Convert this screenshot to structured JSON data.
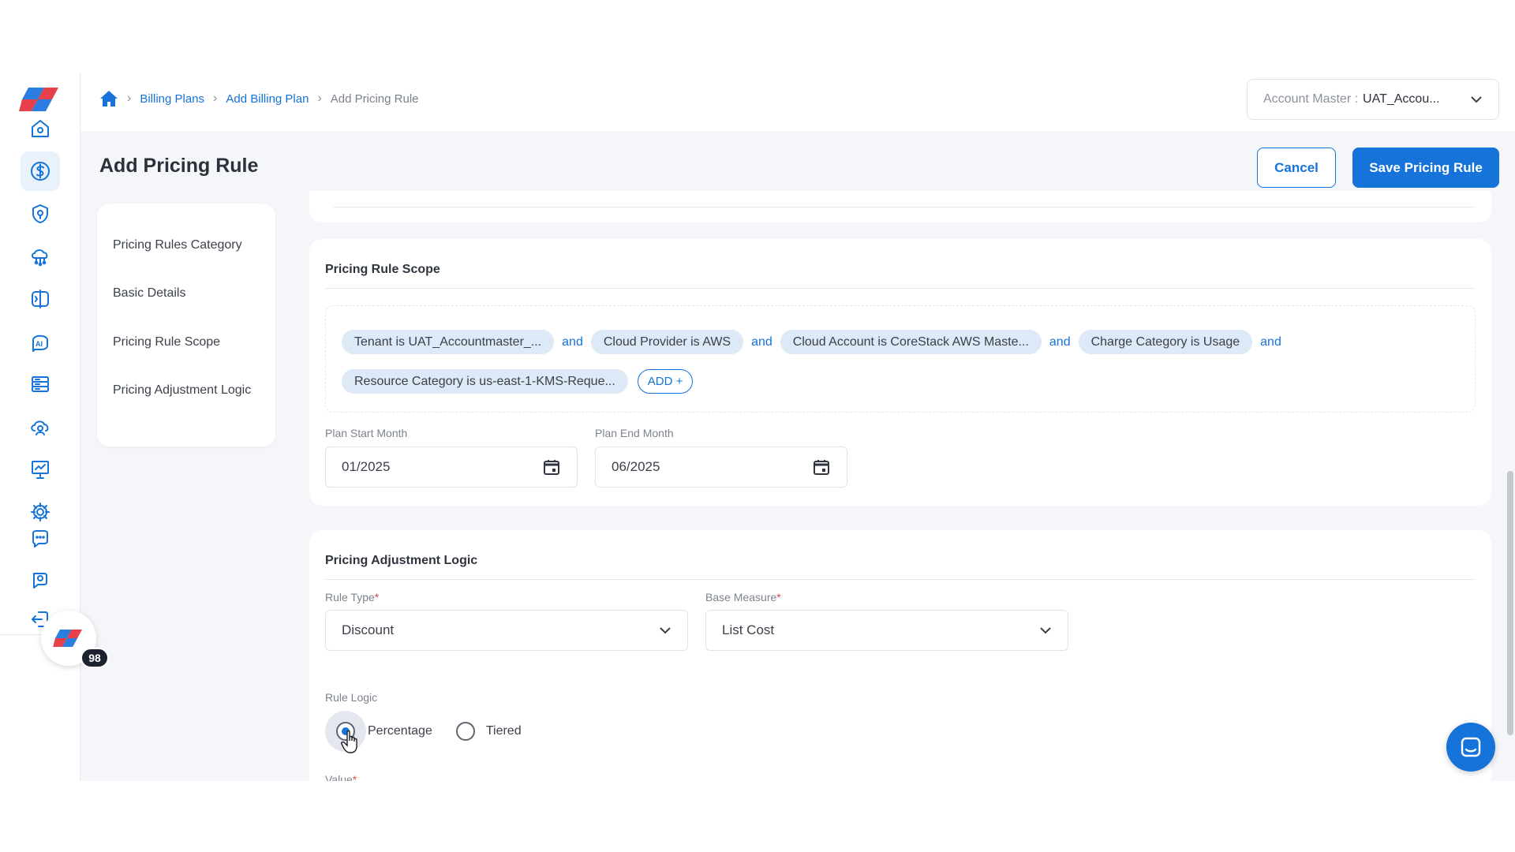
{
  "breadcrumb": {
    "home_icon": "home-icon",
    "items": [
      "Billing Plans",
      "Add Billing Plan"
    ],
    "current": "Add Pricing Rule"
  },
  "account": {
    "label": "Account Master :",
    "value": "UAT_Accou..."
  },
  "header": {
    "title": "Add Pricing Rule",
    "cancel_label": "Cancel",
    "save_label": "Save Pricing Rule"
  },
  "section_nav": [
    "Pricing Rules Category",
    "Basic Details",
    "Pricing Rule Scope",
    "Pricing Adjustment Logic"
  ],
  "scope": {
    "title": "Pricing Rule Scope",
    "conjunction": "and",
    "chips": [
      "Tenant is UAT_Accountmaster_...",
      "Cloud Provider is AWS",
      "Cloud Account is CoreStack AWS Maste...",
      "Charge Category is Usage",
      "Resource Category is us-east-1-KMS-Reque..."
    ],
    "add_label": "ADD +",
    "start_label": "Plan Start Month",
    "start_value": "01/2025",
    "end_label": "Plan End Month",
    "end_value": "06/2025"
  },
  "logic": {
    "title": "Pricing Adjustment Logic",
    "rule_type_label": "Rule Type",
    "rule_type_value": "Discount",
    "base_measure_label": "Base Measure",
    "base_measure_value": "List Cost",
    "rule_logic_label": "Rule Logic",
    "options": [
      "Percentage",
      "Tiered"
    ],
    "selected": "Percentage",
    "value_label": "Value",
    "required_mark": "*"
  },
  "notification_count": "98",
  "colors": {
    "accent": "#1573d9",
    "chip_bg": "#dde9f6",
    "page_bg": "#f4f6fa"
  },
  "sidebar_icons": [
    "home-icon",
    "dollar-icon",
    "shield-icon",
    "cloud-network-icon",
    "split-panel-icon",
    "ai-icon",
    "server-icon",
    "cloud-user-icon",
    "presentation-chart-icon",
    "gear-icon",
    "chat-icon",
    "support-icon",
    "logout-icon"
  ]
}
